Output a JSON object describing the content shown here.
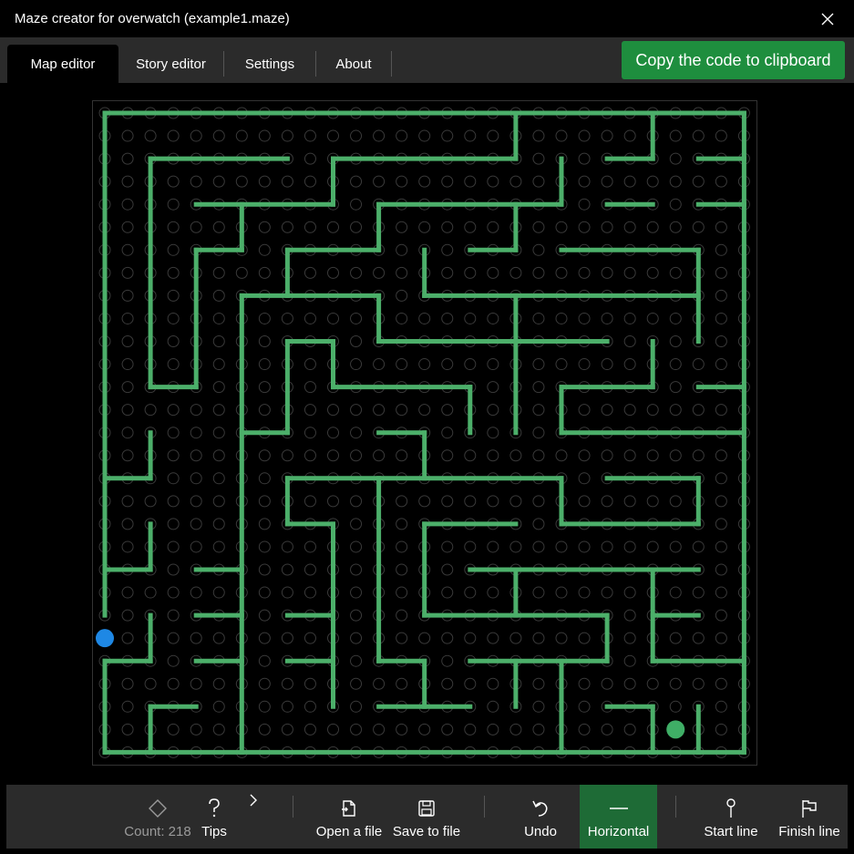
{
  "window": {
    "title": "Maze creator for overwatch (example1.maze)"
  },
  "tabs": [
    {
      "label": "Map editor",
      "active": true
    },
    {
      "label": "Story editor",
      "active": false
    },
    {
      "label": "Settings",
      "active": false
    },
    {
      "label": "About",
      "active": false
    }
  ],
  "copy_button": {
    "label": "Copy the code to clipboard"
  },
  "maze": {
    "grid_size": 29,
    "wall_color": "#4caf6a",
    "dot_color": "#3a3a3a",
    "start_color": "#1e88e5",
    "end_color": "#3fae66",
    "start_point": [
      0,
      23
    ],
    "end_point": [
      25,
      27
    ],
    "walls": [
      [
        0,
        0,
        28,
        0
      ],
      [
        0,
        0,
        0,
        22
      ],
      [
        0,
        24,
        0,
        28
      ],
      [
        0,
        28,
        28,
        28
      ],
      [
        28,
        0,
        28,
        28
      ],
      [
        18,
        0,
        18,
        2
      ],
      [
        24,
        0,
        24,
        2
      ],
      [
        22,
        2,
        24,
        2
      ],
      [
        26,
        2,
        28,
        2
      ],
      [
        2,
        2,
        8,
        2
      ],
      [
        2,
        2,
        2,
        12
      ],
      [
        2,
        12,
        4,
        12
      ],
      [
        10,
        2,
        18,
        2
      ],
      [
        10,
        2,
        10,
        4
      ],
      [
        20,
        2,
        20,
        4
      ],
      [
        4,
        4,
        10,
        4
      ],
      [
        6,
        4,
        6,
        6
      ],
      [
        12,
        4,
        20,
        4
      ],
      [
        12,
        4,
        12,
        6
      ],
      [
        18,
        4,
        18,
        6
      ],
      [
        22,
        4,
        24,
        4
      ],
      [
        26,
        4,
        28,
        4
      ],
      [
        4,
        6,
        6,
        6
      ],
      [
        4,
        6,
        4,
        12
      ],
      [
        8,
        6,
        12,
        6
      ],
      [
        8,
        6,
        8,
        8
      ],
      [
        16,
        6,
        18,
        6
      ],
      [
        20,
        6,
        26,
        6
      ],
      [
        26,
        6,
        26,
        10
      ],
      [
        14,
        6,
        14,
        8
      ],
      [
        6,
        8,
        12,
        8
      ],
      [
        12,
        8,
        12,
        10
      ],
      [
        14,
        8,
        26,
        8
      ],
      [
        18,
        8,
        18,
        14
      ],
      [
        12,
        10,
        22,
        10
      ],
      [
        8,
        10,
        10,
        10
      ],
      [
        8,
        10,
        8,
        14
      ],
      [
        10,
        10,
        10,
        12
      ],
      [
        10,
        12,
        16,
        12
      ],
      [
        16,
        12,
        16,
        14
      ],
      [
        6,
        8,
        6,
        28
      ],
      [
        24,
        10,
        24,
        12
      ],
      [
        20,
        12,
        24,
        12
      ],
      [
        20,
        12,
        20,
        14
      ],
      [
        26,
        12,
        28,
        12
      ],
      [
        20,
        14,
        28,
        14
      ],
      [
        6,
        14,
        8,
        14
      ],
      [
        12,
        14,
        14,
        14
      ],
      [
        14,
        14,
        14,
        16
      ],
      [
        2,
        14,
        2,
        16
      ],
      [
        0,
        16,
        2,
        16
      ],
      [
        8,
        16,
        20,
        16
      ],
      [
        8,
        16,
        8,
        18
      ],
      [
        12,
        16,
        12,
        24
      ],
      [
        20,
        16,
        20,
        18
      ],
      [
        22,
        16,
        26,
        16
      ],
      [
        26,
        16,
        26,
        18
      ],
      [
        20,
        18,
        26,
        18
      ],
      [
        8,
        18,
        10,
        18
      ],
      [
        10,
        18,
        10,
        26
      ],
      [
        14,
        18,
        18,
        18
      ],
      [
        14,
        18,
        14,
        22
      ],
      [
        2,
        18,
        2,
        20
      ],
      [
        0,
        20,
        2,
        20
      ],
      [
        4,
        20,
        6,
        20
      ],
      [
        16,
        20,
        26,
        20
      ],
      [
        18,
        20,
        18,
        22
      ],
      [
        24,
        20,
        24,
        24
      ],
      [
        14,
        22,
        22,
        22
      ],
      [
        22,
        22,
        22,
        24
      ],
      [
        4,
        22,
        6,
        22
      ],
      [
        8,
        22,
        10,
        22
      ],
      [
        2,
        22,
        2,
        24
      ],
      [
        24,
        22,
        26,
        22
      ],
      [
        24,
        24,
        28,
        24
      ],
      [
        12,
        24,
        14,
        24
      ],
      [
        14,
        24,
        14,
        26
      ],
      [
        16,
        24,
        22,
        24
      ],
      [
        18,
        24,
        18,
        26
      ],
      [
        20,
        24,
        20,
        28
      ],
      [
        0,
        24,
        2,
        24
      ],
      [
        4,
        24,
        6,
        24
      ],
      [
        8,
        24,
        10,
        24
      ],
      [
        2,
        26,
        4,
        26
      ],
      [
        2,
        26,
        2,
        28
      ],
      [
        12,
        26,
        16,
        26
      ],
      [
        22,
        26,
        24,
        26
      ],
      [
        24,
        26,
        24,
        28
      ],
      [
        26,
        26,
        26,
        28
      ]
    ]
  },
  "toolbar": {
    "count_label": "Count: 218",
    "tips_label": "Tips",
    "open_label": "Open a file",
    "save_label": "Save to file",
    "undo_label": "Undo",
    "horizontal_label": "Horizontal",
    "start_label": "Start line",
    "finish_label": "Finish line"
  }
}
